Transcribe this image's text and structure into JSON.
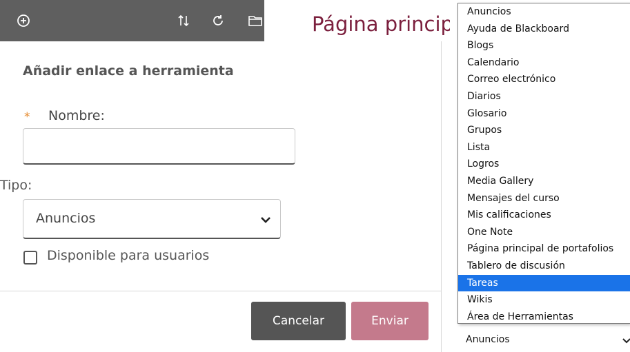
{
  "page": {
    "title": "Página principal"
  },
  "toolbar": {
    "icons": [
      "add-icon",
      "sort-icon",
      "refresh-icon",
      "folder-icon"
    ]
  },
  "form": {
    "title": "Añadir enlace a herramienta",
    "required_mark": "*",
    "name_label": "Nombre:",
    "name_value": "",
    "type_label": "Tipo:",
    "type_value": "Anuncios",
    "available_label": "Disponible para usuarios",
    "available_checked": false,
    "cancel_label": "Cancelar",
    "submit_label": "Enviar"
  },
  "dropdown": {
    "options": [
      "Anuncios",
      "Ayuda de Blackboard",
      "Blogs",
      "Calendario",
      "Correo electrónico",
      "Diarios",
      "Glosario",
      "Grupos",
      "Lista",
      "Logros",
      "Media Gallery",
      "Mensajes del curso",
      "Mis calificaciones",
      "One Note",
      "Página principal de portafolios",
      "Tablero de discusión",
      "Tareas",
      "Wikis",
      "Área de Herramientas"
    ],
    "highlighted": "Tareas",
    "closed_value": "Anuncios"
  },
  "colors": {
    "toolbar": "#5f5f5f",
    "title": "#7b1f3d",
    "required": "#e68a2e",
    "cancel": "#555555",
    "submit": "#c47a8c",
    "highlight": "#1a73e8"
  }
}
